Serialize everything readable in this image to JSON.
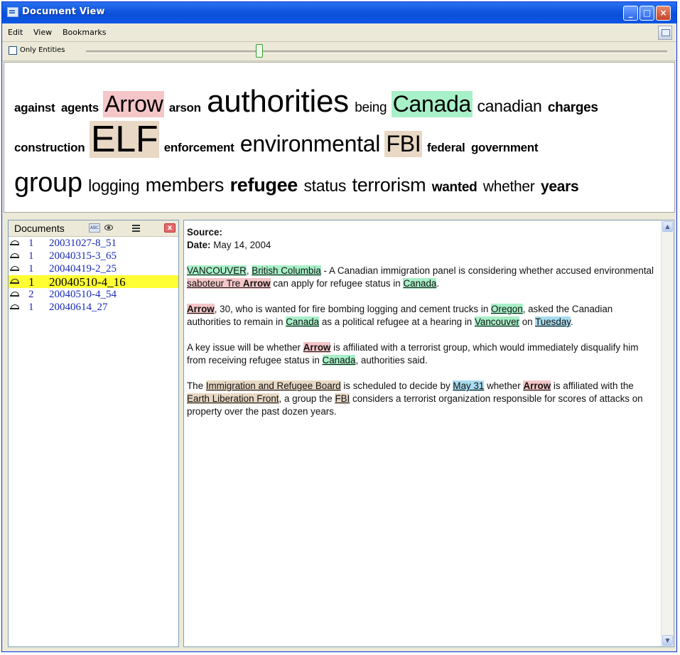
{
  "window": {
    "title": "Document View"
  },
  "title_buttons": {
    "minimize": "_",
    "maximize": "□",
    "close": "×"
  },
  "menubar": {
    "items": [
      "Edit",
      "View",
      "Bookmarks"
    ]
  },
  "toolbar": {
    "only_entities_label": "Only Entities",
    "only_entities_checked": false,
    "slider_level": 0.3
  },
  "colors": {
    "person": "#f5c6c8",
    "location": "#a8f0c8",
    "organization": "#e8d8c4",
    "date": "#a8dcf0",
    "selected_row": "#ffff33"
  },
  "word_cloud": {
    "lines": [
      [
        {
          "text": "against",
          "bold": true
        },
        {
          "text": "agents",
          "bold": true
        },
        {
          "text": "Arrow",
          "type": "person"
        },
        {
          "text": "arson",
          "bold": true
        },
        {
          "text": "authorities"
        },
        {
          "text": "being"
        },
        {
          "text": "Canada",
          "type": "location"
        },
        {
          "text": "canadian"
        },
        {
          "text": "charges",
          "bold": true
        }
      ],
      [
        {
          "text": "construction",
          "bold": true
        },
        {
          "text": "ELF",
          "type": "organization"
        },
        {
          "text": "enforcement",
          "bold": true
        },
        {
          "text": "environmental"
        },
        {
          "text": "FBI",
          "type": "organization"
        },
        {
          "text": "federal",
          "bold": true
        },
        {
          "text": "government",
          "bold": true
        }
      ],
      [
        {
          "text": "group"
        },
        {
          "text": "logging"
        },
        {
          "text": "members"
        },
        {
          "text": "refugee",
          "bold": true
        },
        {
          "text": "status"
        },
        {
          "text": "terrorism"
        },
        {
          "text": "wanted",
          "bold": true
        },
        {
          "text": "whether"
        },
        {
          "text": "years",
          "bold": true
        }
      ]
    ]
  },
  "documents_panel": {
    "title": "Documents",
    "abc_icon": "ABC",
    "close_icon": "x",
    "items": [
      {
        "count": "1",
        "name": "20031027-8_51",
        "selected": false
      },
      {
        "count": "1",
        "name": "20040315-3_65",
        "selected": false
      },
      {
        "count": "1",
        "name": "20040419-2_25",
        "selected": false
      },
      {
        "count": "1",
        "name": "20040510-4_16",
        "selected": true
      },
      {
        "count": "2",
        "name": "20040510-4_54",
        "selected": false
      },
      {
        "count": "1",
        "name": "20040614_27",
        "selected": false
      }
    ]
  },
  "document": {
    "source_label": "Source:",
    "date_label": "Date:",
    "date_value": "May 14, 2004",
    "paragraphs": [
      [
        {
          "t": "VANCOUVER",
          "e": "loc"
        },
        {
          "t": ", "
        },
        {
          "t": "British Columbia",
          "e": "loc"
        },
        {
          "t": " - A Canadian immigration panel is considering whether accused environmental "
        },
        {
          "t": "saboteur Tre ",
          "e": "per"
        },
        {
          "t": "Arrow",
          "e": "per",
          "strong": true
        },
        {
          "t": " can apply for refugee status in "
        },
        {
          "t": "Canada",
          "e": "loc"
        },
        {
          "t": "."
        }
      ],
      [
        {
          "t": "Arrow",
          "e": "per",
          "strong": true
        },
        {
          "t": ", 30, who is wanted for fire bombing logging and cement trucks in "
        },
        {
          "t": "Oregon",
          "e": "loc"
        },
        {
          "t": ", asked the Canadian authorities to remain in "
        },
        {
          "t": "Canada",
          "e": "loc"
        },
        {
          "t": " as a political refugee at a hearing in "
        },
        {
          "t": "Vancouver",
          "e": "loc"
        },
        {
          "t": " on "
        },
        {
          "t": "Tuesday",
          "e": "date"
        },
        {
          "t": "."
        }
      ],
      [
        {
          "t": "A key issue will be whether "
        },
        {
          "t": "Arrow",
          "e": "per",
          "strong": true
        },
        {
          "t": " is affiliated with a terrorist group, which would immediately disqualify him from receiving refugee status in "
        },
        {
          "t": "Canada",
          "e": "loc"
        },
        {
          "t": ", authorities said."
        }
      ],
      [
        {
          "t": "The "
        },
        {
          "t": "Immigration and Refugee Board",
          "e": "org"
        },
        {
          "t": " is scheduled to decide by "
        },
        {
          "t": "May 31",
          "e": "date"
        },
        {
          "t": " whether "
        },
        {
          "t": "Arrow",
          "e": "per",
          "strong": true
        },
        {
          "t": " is affiliated with the "
        },
        {
          "t": "Earth Liberation Front",
          "e": "org"
        },
        {
          "t": ", a group the "
        },
        {
          "t": "FBI",
          "e": "org"
        },
        {
          "t": " considers a terrorist organization responsible for scores of attacks on property over the past dozen years."
        }
      ]
    ]
  },
  "scrollbar": {
    "up": "▲",
    "down": "▼"
  }
}
